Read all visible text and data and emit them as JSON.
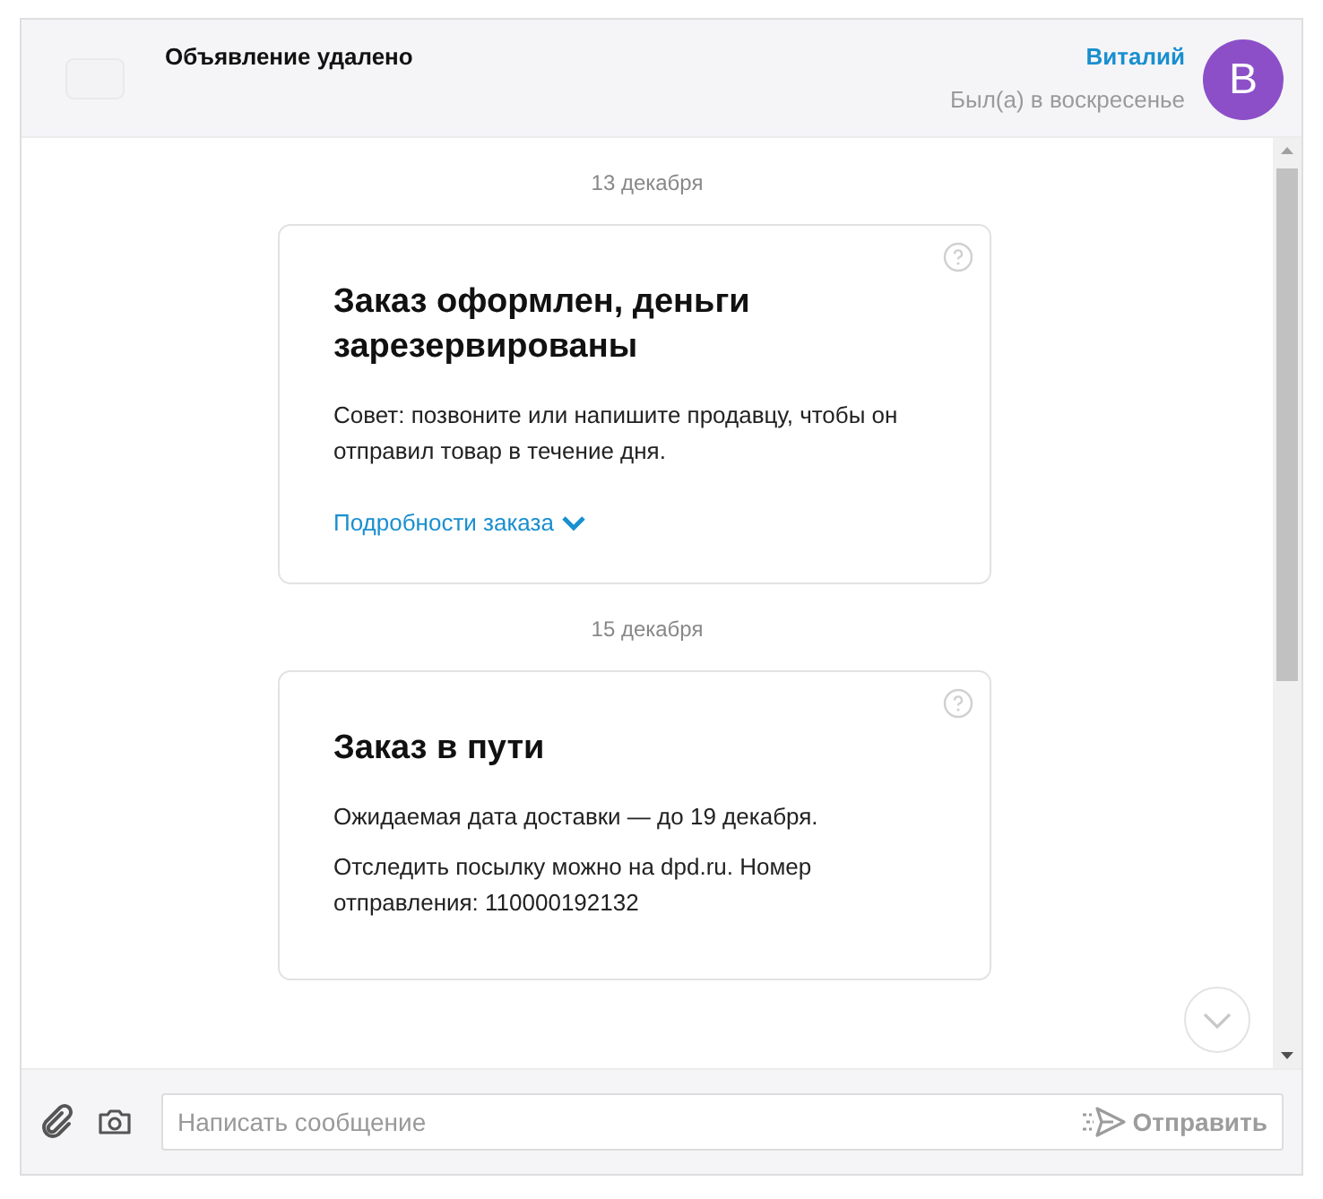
{
  "header": {
    "listing_title": "Объявление удалено",
    "contact_name": "Виталий",
    "last_seen": "Был(а) в воскресенье",
    "avatar_letter": "В"
  },
  "messages": [
    {
      "date": "13 декабря",
      "title": "Заказ оформлен, деньги зарезервированы",
      "paragraphs": [
        "Совет: позвоните или напишите продавцу, чтобы он отправил товар в течение дня."
      ],
      "link": "Подробности заказа"
    },
    {
      "date": "15 декабря",
      "title": "Заказ в пути",
      "paragraphs": [
        "Ожидаемая дата доставки — до 19 декабря.",
        "Отследить посылку можно на dpd.ru. Номер отправления: 110000192132"
      ]
    }
  ],
  "composer": {
    "placeholder": "Написать сообщение",
    "send_label": "Отправить",
    "send_disabled": true
  }
}
